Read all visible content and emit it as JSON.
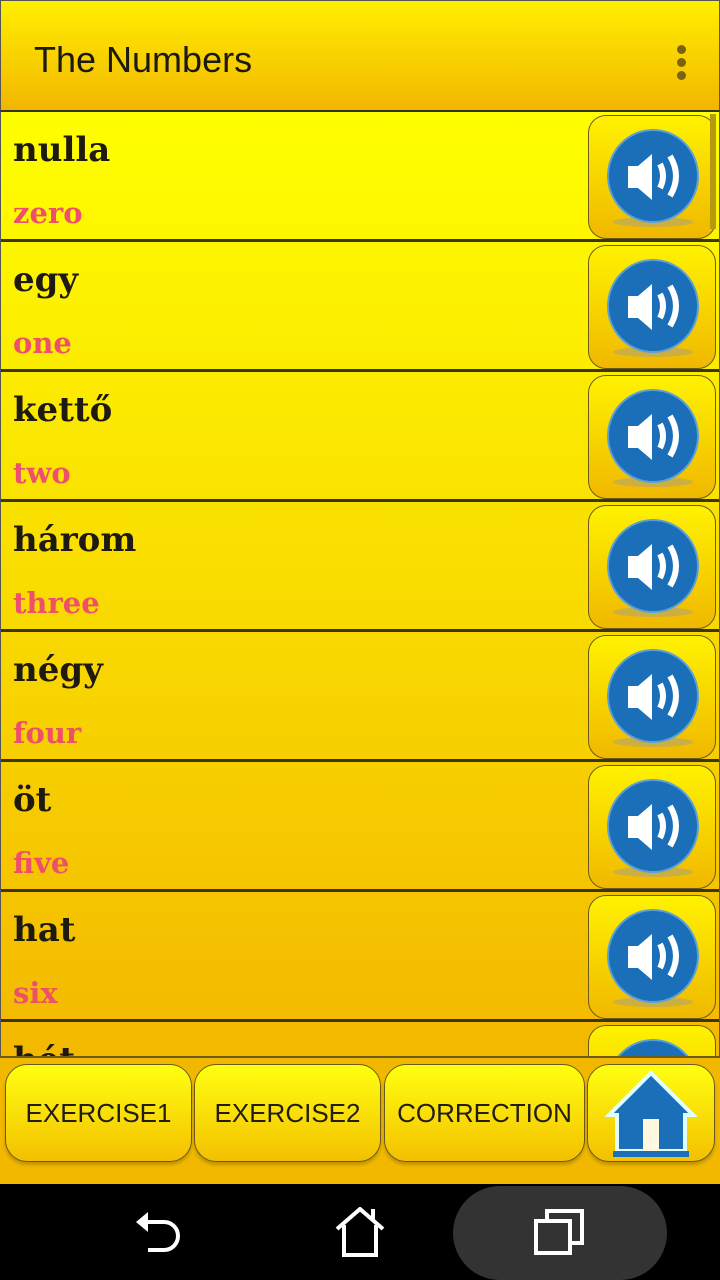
{
  "appbar": {
    "title": "The Numbers",
    "menu_icon": "more-vert-icon"
  },
  "items": [
    {
      "word": "nulla",
      "translation": "zero"
    },
    {
      "word": "egy",
      "translation": "one"
    },
    {
      "word": "kettő",
      "translation": "two"
    },
    {
      "word": "három",
      "translation": "three"
    },
    {
      "word": "négy",
      "translation": "four"
    },
    {
      "word": "öt",
      "translation": "five"
    },
    {
      "word": "hat",
      "translation": "six"
    },
    {
      "word": "hét",
      "translation": ""
    }
  ],
  "bottom": {
    "exercise1": "EXERCISE1",
    "exercise2": "EXERCISE2",
    "correction": "CORRECTION",
    "home_icon": "home-icon"
  },
  "colors": {
    "word": "#1e1a10",
    "translation": "#ee4f6a",
    "speaker": "#1a6fb8"
  }
}
